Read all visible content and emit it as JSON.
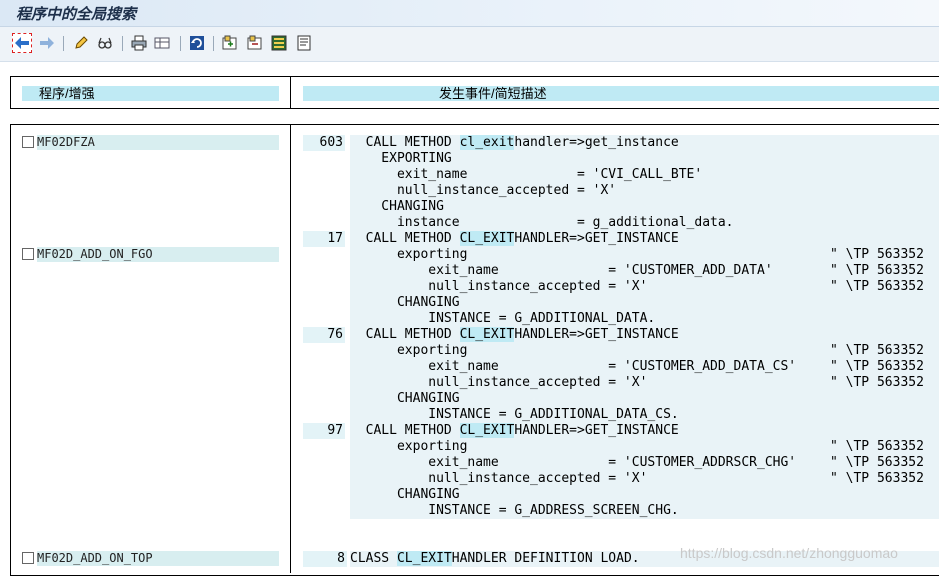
{
  "window": {
    "title": "程序中的全局搜索"
  },
  "toolbar": {
    "buttons": [
      {
        "name": "back-button",
        "icon": "back-arrow-icon"
      },
      {
        "name": "forward-button",
        "icon": "forward-arrow-icon"
      },
      {
        "name": "edit-button",
        "icon": "pencil-icon"
      },
      {
        "name": "display-change-button",
        "icon": "glasses-icon"
      },
      {
        "name": "print-button",
        "icon": "printer-icon"
      },
      {
        "name": "layout-button",
        "icon": "table-icon"
      },
      {
        "name": "refresh-button",
        "icon": "refresh-icon"
      },
      {
        "name": "expand-button",
        "icon": "expand-icon"
      },
      {
        "name": "collapse-button",
        "icon": "collapse-icon"
      },
      {
        "name": "select-all-button",
        "icon": "select-all-icon"
      },
      {
        "name": "details-button",
        "icon": "document-icon"
      }
    ]
  },
  "headers": {
    "program": "程序/增强",
    "description": "发生事件/简短描述"
  },
  "programs": [
    {
      "name": "MF02DFZA",
      "checked": false
    },
    {
      "name": "MF02D_ADD_ON_FGO",
      "checked": false
    },
    {
      "name": "MF02D_ADD_ON_TOP",
      "checked": false
    }
  ],
  "code_lines": [
    {
      "ln": "603",
      "pre": "  CALL METHOD ",
      "hl": "cl_exit",
      "post": "handler=>get_instance",
      "tail": ""
    },
    {
      "ln": "",
      "pre": "    EXPORTING",
      "hl": "",
      "post": "",
      "tail": ""
    },
    {
      "ln": "",
      "pre": "      exit_name              = 'CVI_CALL_BTE'",
      "hl": "",
      "post": "",
      "tail": ""
    },
    {
      "ln": "",
      "pre": "      null_instance_accepted = 'X'",
      "hl": "",
      "post": "",
      "tail": ""
    },
    {
      "ln": "",
      "pre": "    CHANGING",
      "hl": "",
      "post": "",
      "tail": ""
    },
    {
      "ln": "",
      "pre": "      instance               = g_additional_data.",
      "hl": "",
      "post": "",
      "tail": ""
    },
    {
      "ln": "17",
      "pre": "  CALL METHOD ",
      "hl": "CL_EXIT",
      "post": "HANDLER=>GET_INSTANCE",
      "tail": ""
    },
    {
      "ln": "",
      "pre": "      exporting",
      "hl": "",
      "post": "",
      "tail": "\" \\TP 563352"
    },
    {
      "ln": "",
      "pre": "          exit_name              = 'CUSTOMER_ADD_DATA'",
      "hl": "",
      "post": "",
      "tail": "\" \\TP 563352"
    },
    {
      "ln": "",
      "pre": "          null_instance_accepted = 'X'",
      "hl": "",
      "post": "",
      "tail": "\" \\TP 563352"
    },
    {
      "ln": "",
      "pre": "      CHANGING",
      "hl": "",
      "post": "",
      "tail": ""
    },
    {
      "ln": "",
      "pre": "          INSTANCE = G_ADDITIONAL_DATA.",
      "hl": "",
      "post": "",
      "tail": ""
    },
    {
      "ln": "76",
      "pre": "  CALL METHOD ",
      "hl": "CL_EXIT",
      "post": "HANDLER=>GET_INSTANCE",
      "tail": ""
    },
    {
      "ln": "",
      "pre": "      exporting",
      "hl": "",
      "post": "",
      "tail": "\" \\TP 563352"
    },
    {
      "ln": "",
      "pre": "          exit_name              = 'CUSTOMER_ADD_DATA_CS'",
      "hl": "",
      "post": "",
      "tail": "\" \\TP 563352"
    },
    {
      "ln": "",
      "pre": "          null_instance_accepted = 'X'",
      "hl": "",
      "post": "",
      "tail": "\" \\TP 563352"
    },
    {
      "ln": "",
      "pre": "      CHANGING",
      "hl": "",
      "post": "",
      "tail": ""
    },
    {
      "ln": "",
      "pre": "          INSTANCE = G_ADDITIONAL_DATA_CS.",
      "hl": "",
      "post": "",
      "tail": ""
    },
    {
      "ln": "97",
      "pre": "  CALL METHOD ",
      "hl": "CL_EXIT",
      "post": "HANDLER=>GET_INSTANCE",
      "tail": ""
    },
    {
      "ln": "",
      "pre": "      exporting",
      "hl": "",
      "post": "",
      "tail": "\" \\TP 563352"
    },
    {
      "ln": "",
      "pre": "          exit_name              = 'CUSTOMER_ADDRSCR_CHG'",
      "hl": "",
      "post": "",
      "tail": "\" \\TP 563352"
    },
    {
      "ln": "",
      "pre": "          null_instance_accepted = 'X'",
      "hl": "",
      "post": "",
      "tail": "\" \\TP 563352"
    },
    {
      "ln": "",
      "pre": "      CHANGING",
      "hl": "",
      "post": "",
      "tail": ""
    },
    {
      "ln": "",
      "pre": "          INSTANCE = G_ADDRESS_SCREEN_CHG.",
      "hl": "",
      "post": "",
      "tail": ""
    },
    {
      "ln": "8",
      "pre": "CLASS ",
      "hl": "CL_EXIT",
      "post": "HANDLER DEFINITION LOAD.",
      "tail": ""
    }
  ],
  "watermark": "https://blog.csdn.net/zhongguomao"
}
